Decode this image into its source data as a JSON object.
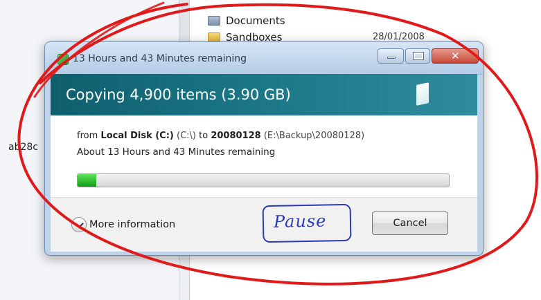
{
  "background": {
    "files": [
      {
        "name": "Documents",
        "date": "",
        "icon": "documents-folder-icon"
      },
      {
        "name": "Sandboxes",
        "date": "28/01/2008",
        "icon": "folder-icon"
      }
    ],
    "clipped_text": "ab28c"
  },
  "dialog": {
    "title": "13 Hours and 43 Minutes remaining",
    "header": "Copying 4,900 items (3.90 GB)",
    "from_prefix": "from",
    "source_name": "Local Disk (C:)",
    "source_path": "(C:\\)",
    "to_word": "to",
    "dest_name": "20080128",
    "dest_path": "(E:\\Backup\\20080128)",
    "remaining": "About 13 Hours and 43 Minutes remaining",
    "progress_fraction": 0.05,
    "more_info_label": "More information",
    "cancel_label": "Cancel",
    "handwritten_note": "Pause"
  },
  "colors": {
    "header_band": "#1a7585",
    "progress_fill": "#1bb51b",
    "annotation_red": "#e0191b",
    "annotation_blue": "#2a3bbd"
  }
}
